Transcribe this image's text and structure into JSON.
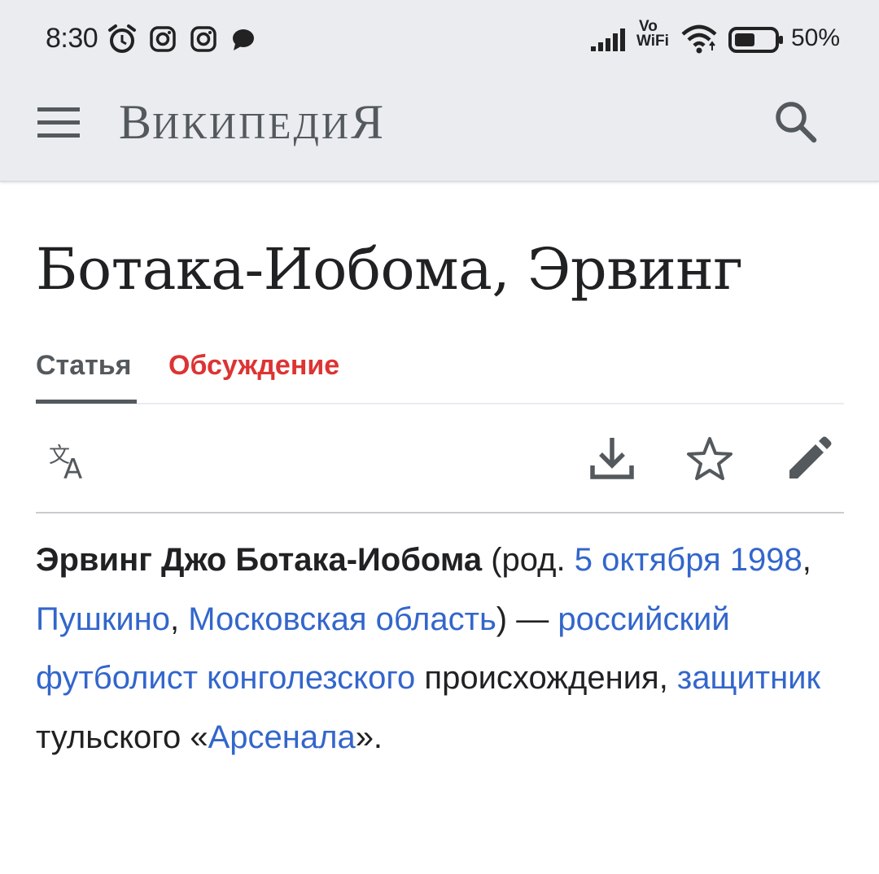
{
  "status_bar": {
    "time": "8:30",
    "battery_percent": "50%",
    "network_label_top": "Vo",
    "network_label_bottom": "WiFi",
    "icons": [
      "alarm-icon",
      "instagram-icon",
      "instagram-icon",
      "chat-icon",
      "signal-icon",
      "wifi-icon",
      "battery-icon"
    ]
  },
  "app_bar": {
    "wordmark_cap": "В",
    "wordmark_small": "ИКИПЕДИ",
    "wordmark_end": "Я",
    "menu_icon": "menu-icon",
    "search_icon": "search-icon"
  },
  "article": {
    "title": "Ботака-Иобома, Эрвинг",
    "tabs": [
      {
        "label": "Статья",
        "active": true
      },
      {
        "label": "Обсуждение",
        "active": false
      }
    ],
    "actions": [
      "translate-icon",
      "download-icon",
      "star-icon",
      "edit-icon"
    ],
    "lead": {
      "bold_name": "Эрвинг Джо Ботака-Иобома",
      "t1": " (род. ",
      "link_date": "5 октября 1998",
      "t2": ", ",
      "link_city": "Пушкино",
      "t3": ", ",
      "link_region": "Московская область",
      "t4": ") — ",
      "link_footballer": "российский футболист конголезского",
      "t5": " происхождения, ",
      "link_defender": "защитник",
      "t6": " тульского «",
      "link_club": "Арсенала",
      "t7": "»."
    }
  },
  "colors": {
    "link": "#3366cc",
    "talk_tab": "#dd3333",
    "bar_background": "#eaecf0",
    "icon": "#54595d"
  }
}
